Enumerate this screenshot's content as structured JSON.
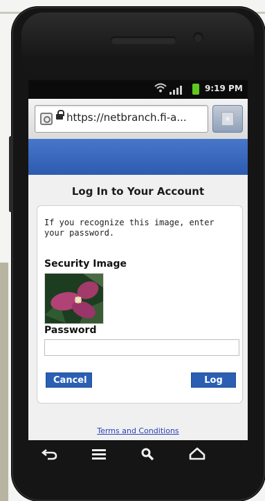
{
  "status_bar": {
    "time": "9:19 PM"
  },
  "browser": {
    "url": "https://netbranch.fi-a..."
  },
  "page": {
    "title": "Log In to Your Account",
    "instructions": "If you recognize this image, enter your password.",
    "security_image_label": "Security Image",
    "password_label": "Password",
    "password_value": "",
    "cancel_label": "Cancel",
    "login_label": "Log In",
    "terms_link": "Terms and Conditions"
  },
  "colors": {
    "header_blue": "#2d5bb1",
    "button_blue": "#2a5fb4",
    "link_blue": "#2b41b8",
    "battery_green": "#5fc81f"
  },
  "icons": {
    "status": [
      "wifi-icon",
      "signal-icon",
      "battery-icon"
    ],
    "url_bar": [
      "site-favicon-icon",
      "lock-icon",
      "bookmark-star-icon"
    ],
    "nav": [
      "back-icon",
      "menu-icon",
      "search-icon",
      "home-icon"
    ],
    "security_image": "trillium-flower-image"
  }
}
